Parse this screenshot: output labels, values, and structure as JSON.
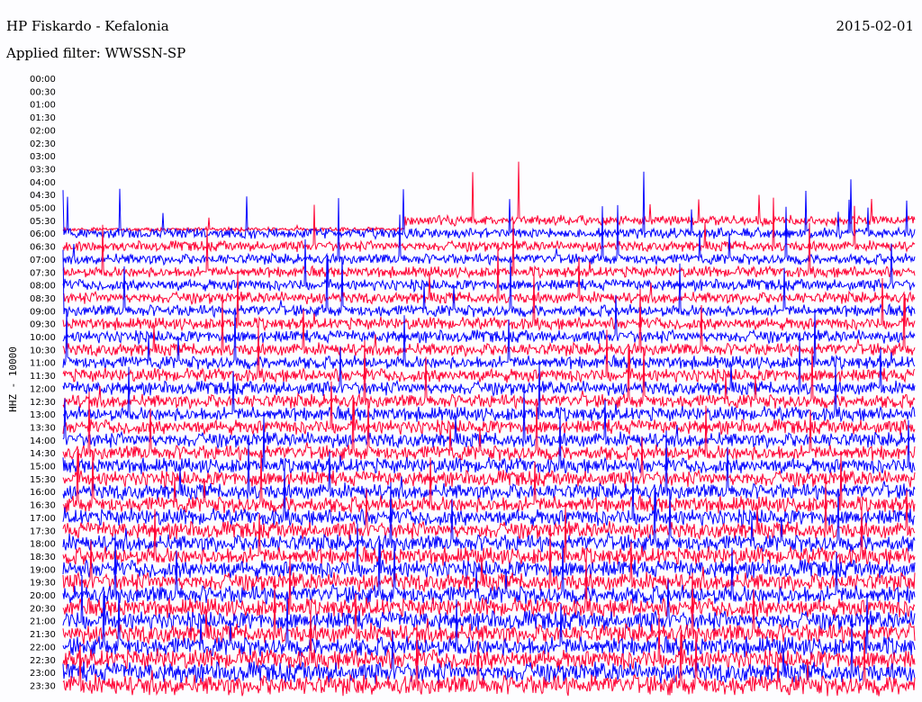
{
  "header": {
    "station": "HP Fiskardo - Kefalonia",
    "filter": "Applied filter: WWSSN-SP",
    "date": "2015-02-01"
  },
  "chart_data": {
    "type": "line",
    "title": "HP Fiskardo - Kefalonia",
    "subtitle": "Applied filter: WWSSN-SP",
    "ylabel": "HHZ - 10000",
    "row_labels": [
      "00:00",
      "00:30",
      "01:00",
      "01:30",
      "02:00",
      "02:30",
      "03:00",
      "03:30",
      "04:00",
      "04:30",
      "05:00",
      "05:30",
      "06:00",
      "06:30",
      "07:00",
      "07:30",
      "08:00",
      "08:30",
      "09:00",
      "09:30",
      "10:00",
      "10:30",
      "11:00",
      "11:30",
      "12:00",
      "12:30",
      "13:00",
      "13:30",
      "14:00",
      "14:30",
      "15:00",
      "15:30",
      "16:00",
      "16:30",
      "17:00",
      "17:30",
      "18:00",
      "18:30",
      "19:00",
      "19:30",
      "20:00",
      "20:30",
      "21:00",
      "21:30",
      "22:00",
      "22:30",
      "23:00",
      "23:30"
    ],
    "first_trace_row": "05:30",
    "series_colors": [
      "#0000ff",
      "#ff0033"
    ]
  }
}
